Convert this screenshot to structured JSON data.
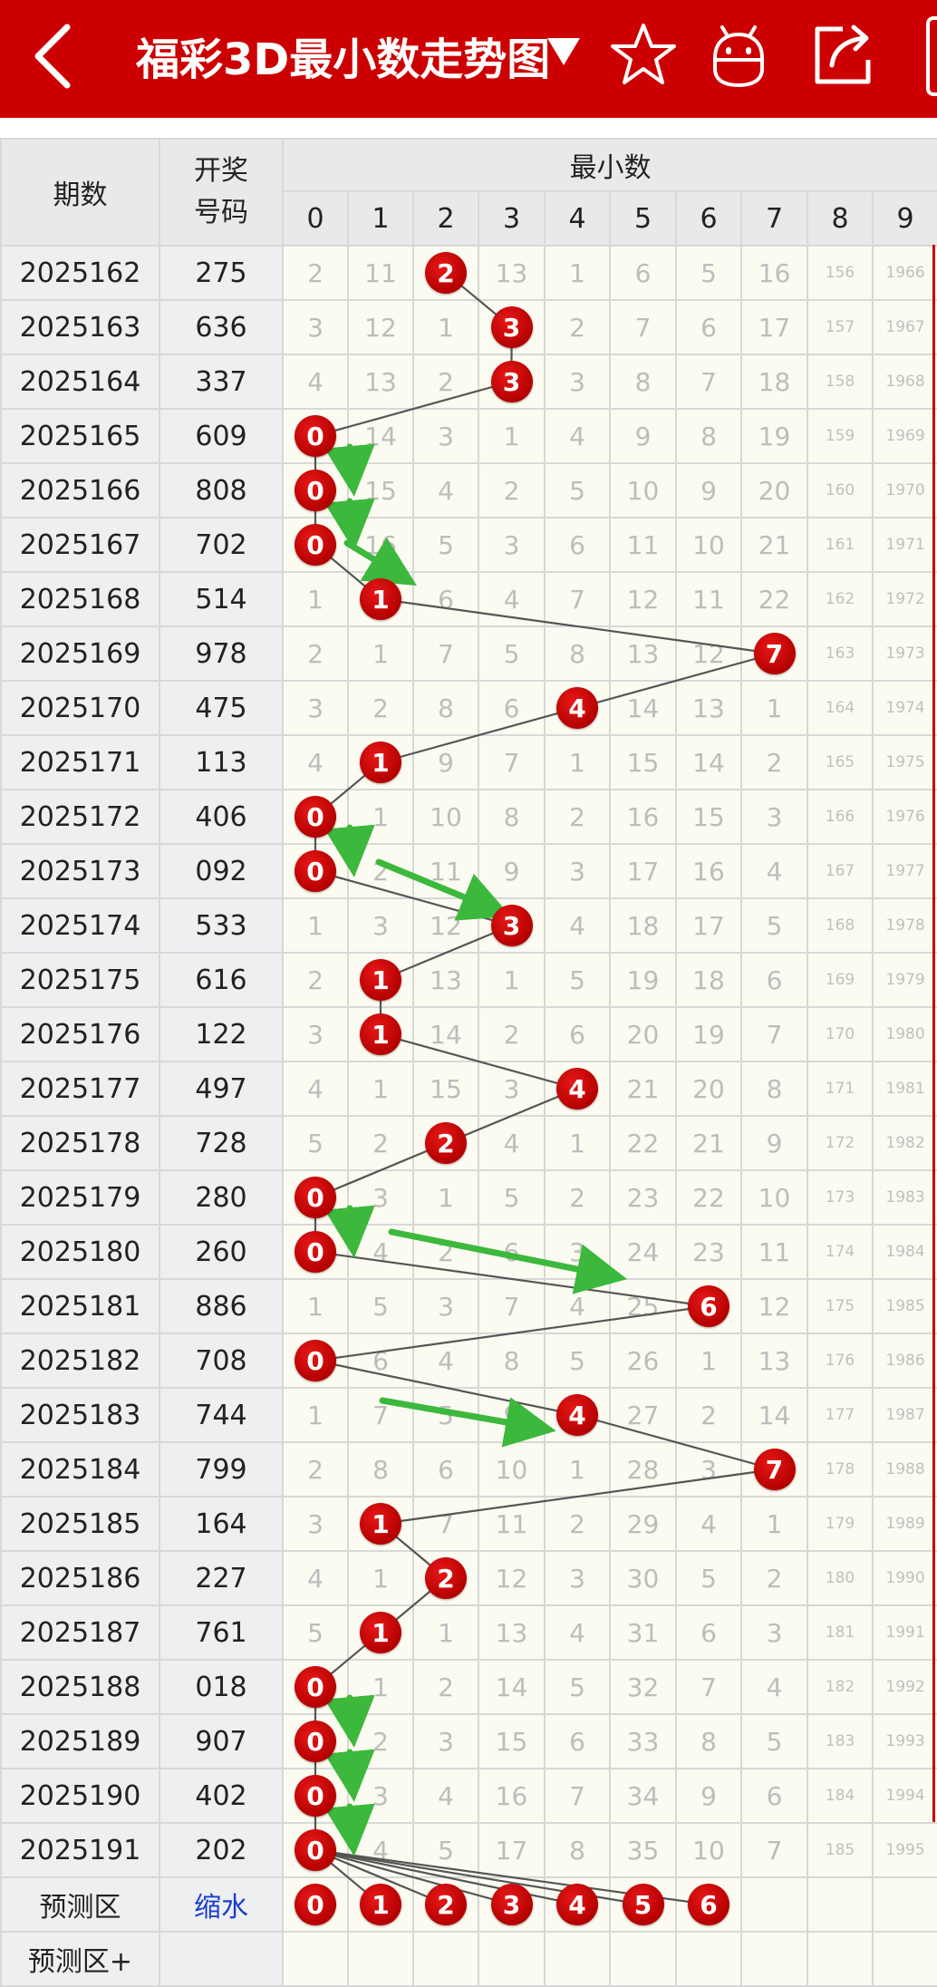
{
  "header": {
    "title": "福彩3D最小数走势图",
    "icons": [
      "back-icon",
      "dropdown-triangle-icon",
      "star-icon",
      "robot-icon",
      "share-icon"
    ],
    "accent": "#cc0000"
  },
  "table": {
    "col_issue": "期数",
    "col_draw_1": "开奖",
    "col_draw_2": "号码",
    "col_group": "最小数",
    "digits": [
      "0",
      "1",
      "2",
      "3",
      "4",
      "5",
      "6",
      "7",
      "8",
      "9"
    ],
    "rows": [
      {
        "issue": "2025162",
        "draw": "275",
        "hit": 2,
        "cells": [
          "2",
          "11",
          "2",
          "13",
          "1",
          "6",
          "5",
          "16",
          "156",
          "1966"
        ]
      },
      {
        "issue": "2025163",
        "draw": "636",
        "hit": 3,
        "cells": [
          "3",
          "12",
          "1",
          "3",
          "2",
          "7",
          "6",
          "17",
          "157",
          "1967"
        ]
      },
      {
        "issue": "2025164",
        "draw": "337",
        "hit": 3,
        "cells": [
          "4",
          "13",
          "2",
          "3",
          "3",
          "8",
          "7",
          "18",
          "158",
          "1968"
        ]
      },
      {
        "issue": "2025165",
        "draw": "609",
        "hit": 0,
        "cells": [
          "0",
          "14",
          "3",
          "1",
          "4",
          "9",
          "8",
          "19",
          "159",
          "1969"
        ]
      },
      {
        "issue": "2025166",
        "draw": "808",
        "hit": 0,
        "cells": [
          "0",
          "15",
          "4",
          "2",
          "5",
          "10",
          "9",
          "20",
          "160",
          "1970"
        ]
      },
      {
        "issue": "2025167",
        "draw": "702",
        "hit": 0,
        "cells": [
          "0",
          "16",
          "5",
          "3",
          "6",
          "11",
          "10",
          "21",
          "161",
          "1971"
        ]
      },
      {
        "issue": "2025168",
        "draw": "514",
        "hit": 1,
        "cells": [
          "1",
          "1",
          "6",
          "4",
          "7",
          "12",
          "11",
          "22",
          "162",
          "1972"
        ]
      },
      {
        "issue": "2025169",
        "draw": "978",
        "hit": 7,
        "cells": [
          "2",
          "1",
          "7",
          "5",
          "8",
          "13",
          "12",
          "7",
          "163",
          "1973"
        ]
      },
      {
        "issue": "2025170",
        "draw": "475",
        "hit": 4,
        "cells": [
          "3",
          "2",
          "8",
          "6",
          "4",
          "14",
          "13",
          "1",
          "164",
          "1974"
        ]
      },
      {
        "issue": "2025171",
        "draw": "113",
        "hit": 1,
        "cells": [
          "4",
          "1",
          "9",
          "7",
          "1",
          "15",
          "14",
          "2",
          "165",
          "1975"
        ]
      },
      {
        "issue": "2025172",
        "draw": "406",
        "hit": 0,
        "cells": [
          "0",
          "1",
          "10",
          "8",
          "2",
          "16",
          "15",
          "3",
          "166",
          "1976"
        ]
      },
      {
        "issue": "2025173",
        "draw": "092",
        "hit": 0,
        "cells": [
          "0",
          "2",
          "11",
          "9",
          "3",
          "17",
          "16",
          "4",
          "167",
          "1977"
        ]
      },
      {
        "issue": "2025174",
        "draw": "533",
        "hit": 3,
        "cells": [
          "1",
          "3",
          "12",
          "3",
          "4",
          "18",
          "17",
          "5",
          "168",
          "1978"
        ]
      },
      {
        "issue": "2025175",
        "draw": "616",
        "hit": 1,
        "cells": [
          "2",
          "1",
          "13",
          "1",
          "5",
          "19",
          "18",
          "6",
          "169",
          "1979"
        ]
      },
      {
        "issue": "2025176",
        "draw": "122",
        "hit": 1,
        "cells": [
          "3",
          "1",
          "14",
          "2",
          "6",
          "20",
          "19",
          "7",
          "170",
          "1980"
        ]
      },
      {
        "issue": "2025177",
        "draw": "497",
        "hit": 4,
        "cells": [
          "4",
          "1",
          "15",
          "3",
          "4",
          "21",
          "20",
          "8",
          "171",
          "1981"
        ]
      },
      {
        "issue": "2025178",
        "draw": "728",
        "hit": 2,
        "cells": [
          "5",
          "2",
          "2",
          "4",
          "1",
          "22",
          "21",
          "9",
          "172",
          "1982"
        ]
      },
      {
        "issue": "2025179",
        "draw": "280",
        "hit": 0,
        "cells": [
          "0",
          "3",
          "1",
          "5",
          "2",
          "23",
          "22",
          "10",
          "173",
          "1983"
        ]
      },
      {
        "issue": "2025180",
        "draw": "260",
        "hit": 0,
        "cells": [
          "0",
          "4",
          "2",
          "6",
          "3",
          "24",
          "23",
          "11",
          "174",
          "1984"
        ]
      },
      {
        "issue": "2025181",
        "draw": "886",
        "hit": 6,
        "cells": [
          "1",
          "5",
          "3",
          "7",
          "4",
          "25",
          "6",
          "12",
          "175",
          "1985"
        ]
      },
      {
        "issue": "2025182",
        "draw": "708",
        "hit": 0,
        "cells": [
          "0",
          "6",
          "4",
          "8",
          "5",
          "26",
          "1",
          "13",
          "176",
          "1986"
        ]
      },
      {
        "issue": "2025183",
        "draw": "744",
        "hit": 4,
        "cells": [
          "1",
          "7",
          "5",
          "9",
          "4",
          "27",
          "2",
          "14",
          "177",
          "1987"
        ]
      },
      {
        "issue": "2025184",
        "draw": "799",
        "hit": 7,
        "cells": [
          "2",
          "8",
          "6",
          "10",
          "1",
          "28",
          "3",
          "7",
          "178",
          "1988"
        ]
      },
      {
        "issue": "2025185",
        "draw": "164",
        "hit": 1,
        "cells": [
          "3",
          "1",
          "7",
          "11",
          "2",
          "29",
          "4",
          "1",
          "179",
          "1989"
        ]
      },
      {
        "issue": "2025186",
        "draw": "227",
        "hit": 2,
        "cells": [
          "4",
          "1",
          "2",
          "12",
          "3",
          "30",
          "5",
          "2",
          "180",
          "1990"
        ]
      },
      {
        "issue": "2025187",
        "draw": "761",
        "hit": 1,
        "cells": [
          "5",
          "1",
          "1",
          "13",
          "4",
          "31",
          "6",
          "3",
          "181",
          "1991"
        ]
      },
      {
        "issue": "2025188",
        "draw": "018",
        "hit": 0,
        "cells": [
          "0",
          "1",
          "2",
          "14",
          "5",
          "32",
          "7",
          "4",
          "182",
          "1992"
        ]
      },
      {
        "issue": "2025189",
        "draw": "907",
        "hit": 0,
        "cells": [
          "0",
          "2",
          "3",
          "15",
          "6",
          "33",
          "8",
          "5",
          "183",
          "1993"
        ]
      },
      {
        "issue": "2025190",
        "draw": "402",
        "hit": 0,
        "cells": [
          "0",
          "3",
          "4",
          "16",
          "7",
          "34",
          "9",
          "6",
          "184",
          "1994"
        ]
      },
      {
        "issue": "2025191",
        "draw": "202",
        "hit": 0,
        "cells": [
          "0",
          "4",
          "5",
          "17",
          "8",
          "35",
          "10",
          "7",
          "185",
          "1995"
        ]
      }
    ],
    "predict_label": "预测区",
    "predict_action": "缩水",
    "predict_balls": [
      "0",
      "1",
      "2",
      "3",
      "4",
      "5",
      "6"
    ],
    "predict_plus_label": "预测区+"
  },
  "colors": {
    "ball": "#cc0000",
    "trend_line": "#555555",
    "arrow": "#3cb83c",
    "cell_bg": "#fbfbf1",
    "header_bg": "#e8e9eb",
    "predict_blue": "#1a3fc9"
  }
}
